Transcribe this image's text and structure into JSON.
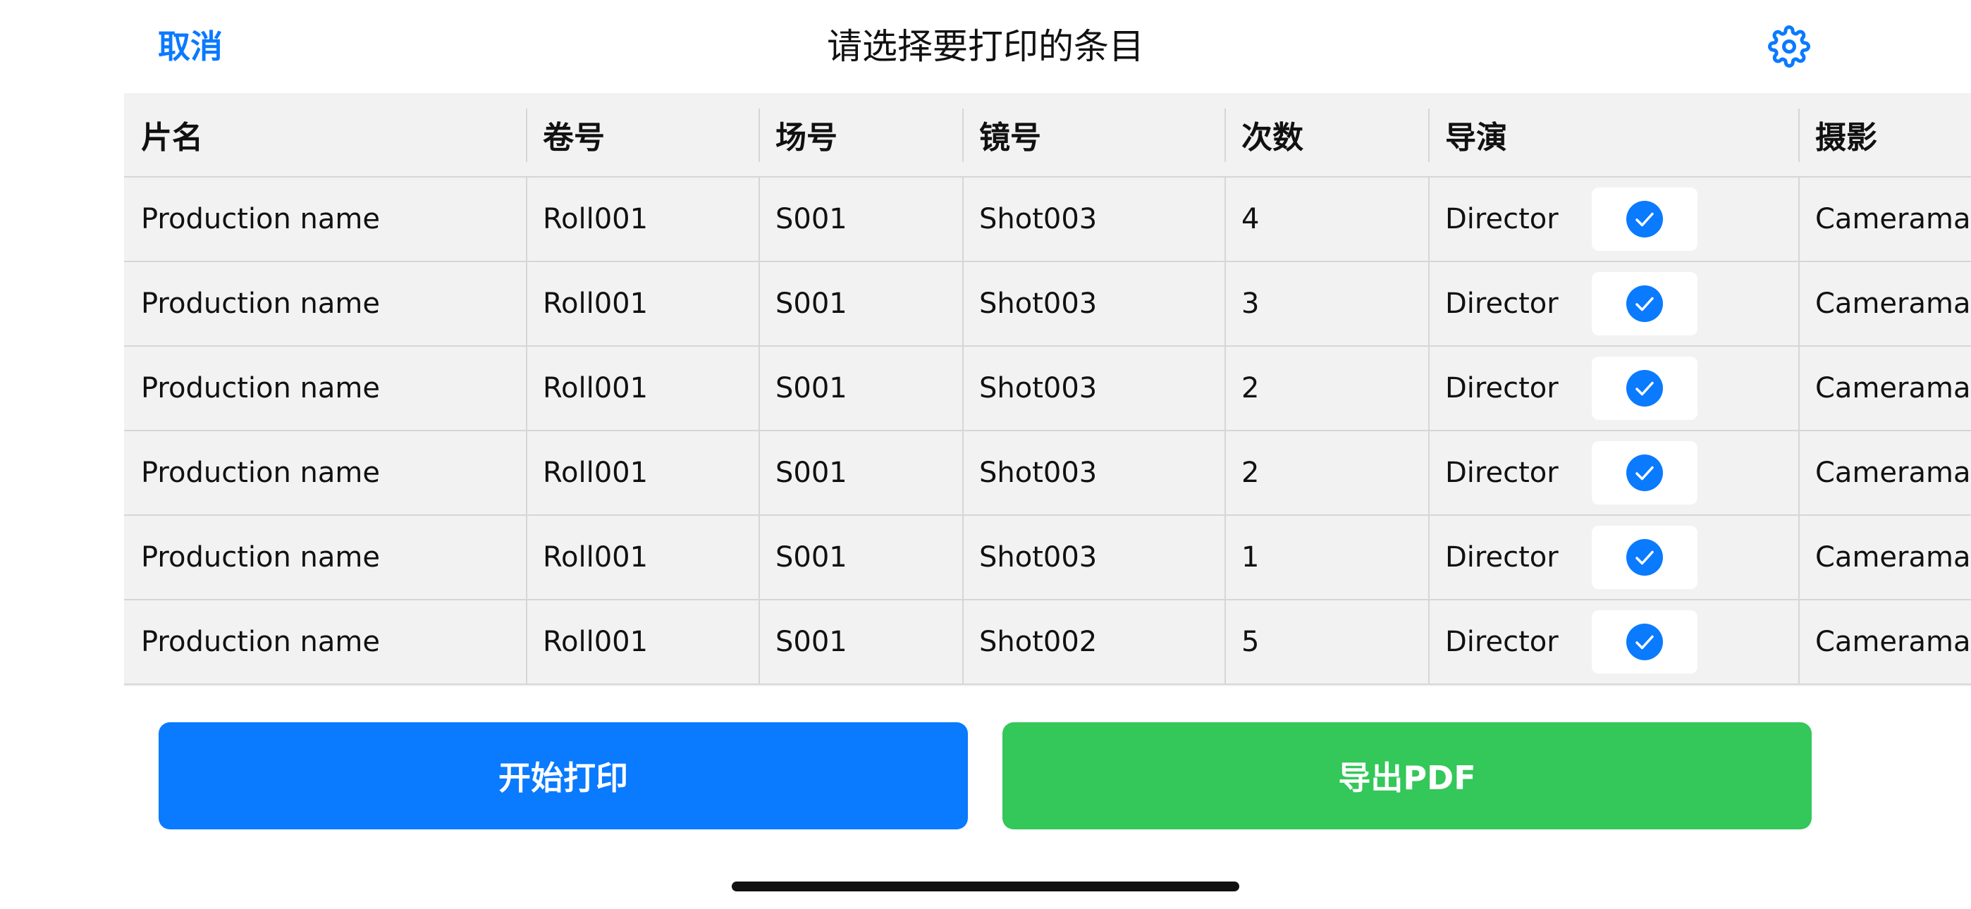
{
  "nav": {
    "cancel_label": "取消",
    "title": "请选择要打印的条目",
    "settings_icon": "gear-icon"
  },
  "colors": {
    "accent": "#0a7aff",
    "print_button": "#0a7aff",
    "export_button": "#34c759",
    "table_background": "#f2f2f2"
  },
  "table": {
    "columns": [
      "片名",
      "卷号",
      "场号",
      "镜号",
      "次数",
      "导演",
      "摄影"
    ],
    "rows": [
      {
        "production": "Production name",
        "roll": "Roll001",
        "scene": "S001",
        "shot": "Shot003",
        "take": "4",
        "director": "Director",
        "selected": true,
        "camera": "Cameraman"
      },
      {
        "production": "Production name",
        "roll": "Roll001",
        "scene": "S001",
        "shot": "Shot003",
        "take": "3",
        "director": "Director",
        "selected": true,
        "camera": "Cameraman"
      },
      {
        "production": "Production name",
        "roll": "Roll001",
        "scene": "S001",
        "shot": "Shot003",
        "take": "2",
        "director": "Director",
        "selected": true,
        "camera": "Cameraman"
      },
      {
        "production": "Production name",
        "roll": "Roll001",
        "scene": "S001",
        "shot": "Shot003",
        "take": "2",
        "director": "Director",
        "selected": true,
        "camera": "Cameraman"
      },
      {
        "production": "Production name",
        "roll": "Roll001",
        "scene": "S001",
        "shot": "Shot003",
        "take": "1",
        "director": "Director",
        "selected": true,
        "camera": "Cameraman"
      },
      {
        "production": "Production name",
        "roll": "Roll001",
        "scene": "S001",
        "shot": "Shot002",
        "take": "5",
        "director": "Director",
        "selected": true,
        "camera": "Cameraman"
      }
    ]
  },
  "actions": {
    "print_label": "开始打印",
    "export_label": "导出PDF"
  }
}
